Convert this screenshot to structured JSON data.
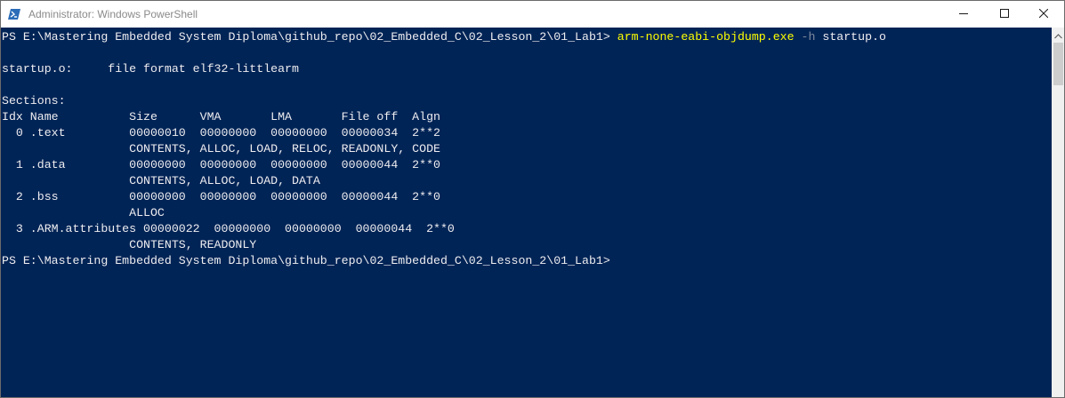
{
  "window": {
    "title": "Administrator: Windows PowerShell",
    "app_icon": "powershell-icon",
    "buttons": {
      "minimize": "minimize-icon",
      "maximize": "maximize-icon",
      "close": "close-icon"
    }
  },
  "colors": {
    "console_background": "#012456",
    "console_text": "#eeedf0",
    "command_name": "#ffff00",
    "command_parameter": "#7f8b9e",
    "title_text": "#8a8a8a"
  },
  "console": {
    "prompt": "PS E:\\Mastering Embedded System Diploma\\github_repo\\02_Embedded_C\\02_Lesson_2\\01_Lab1> ",
    "command": "arm-none-eabi-objdump.exe",
    "parameter": " -h",
    "argument": " startup.o",
    "output_lines": [
      "",
      "startup.o:     file format elf32-littlearm",
      "",
      "Sections:",
      "Idx Name          Size      VMA       LMA       File off  Algn",
      "  0 .text         00000010  00000000  00000000  00000034  2**2",
      "                  CONTENTS, ALLOC, LOAD, RELOC, READONLY, CODE",
      "  1 .data         00000000  00000000  00000000  00000044  2**0",
      "                  CONTENTS, ALLOC, LOAD, DATA",
      "  2 .bss          00000000  00000000  00000000  00000044  2**0",
      "                  ALLOC",
      "  3 .ARM.attributes 00000022  00000000  00000000  00000044  2**0",
      "                  CONTENTS, READONLY"
    ],
    "final_prompt": "PS E:\\Mastering Embedded System Diploma\\github_repo\\02_Embedded_C\\02_Lesson_2\\01_Lab1>"
  }
}
